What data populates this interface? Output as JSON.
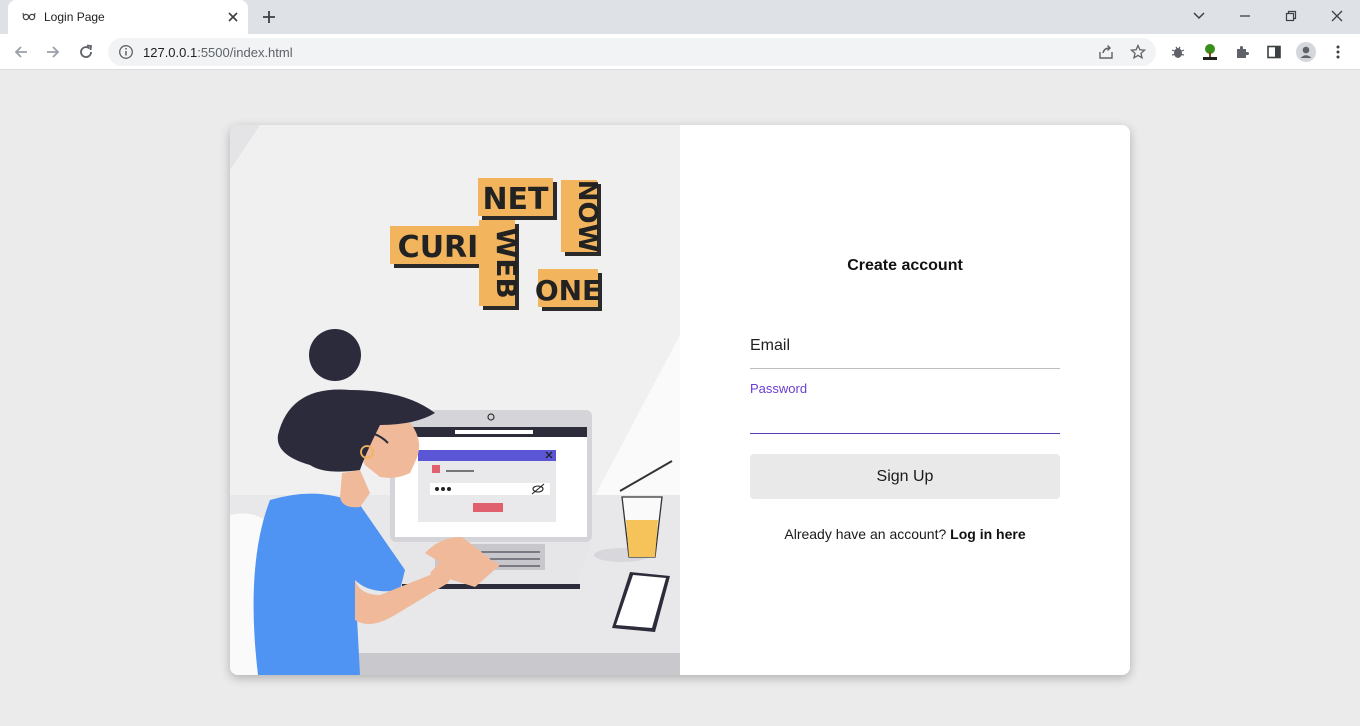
{
  "browser": {
    "tab_title": "Login Page",
    "url_host": "127.0.0.1",
    "url_rest": ":5500/index.html"
  },
  "illustration": {
    "words": [
      "NET",
      "NOW",
      "CURI",
      "WEB",
      "ONE"
    ]
  },
  "form": {
    "title": "Create account",
    "email_label": "Email",
    "password_label": "Password",
    "signup_label": "Sign Up",
    "login_prompt": "Already have an account?",
    "login_link": "Log in here"
  },
  "colors": {
    "accent": "#6a3fd0",
    "page_bg": "#ebebeb"
  }
}
